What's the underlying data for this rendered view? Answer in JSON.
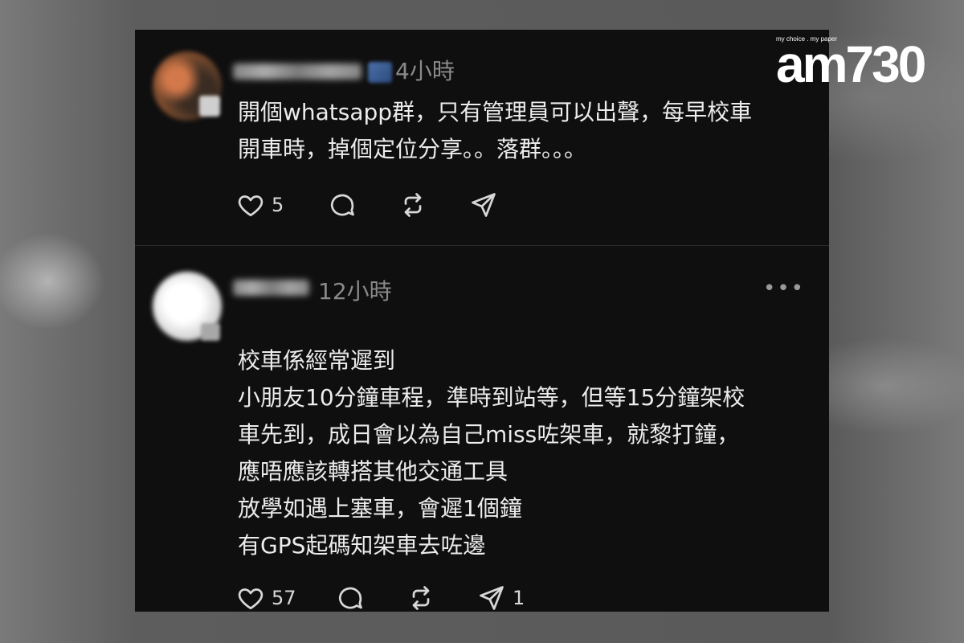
{
  "brand": {
    "tagline": "my choice . my paper",
    "logo_text": "am730"
  },
  "posts": [
    {
      "time": "4小時",
      "text": "開個whatsapp群，只有管理員可以出聲，每早校車\n開車時，掉個定位分享。。落群。。。",
      "likes": "5",
      "shares": ""
    },
    {
      "time": "12小時",
      "more_icon": "•••",
      "text": "校車係經常遲到\n小朋友10分鐘車程，準時到站等，但等15分鐘架校\n車先到，成日會以為自己miss咗架車，就黎打鐘，\n應唔應該轉搭其他交通工具\n放學如遇上塞車，會遲1個鐘\n有GPS起碼知架車去咗邊",
      "likes": "57",
      "shares": "1"
    }
  ],
  "icons": {
    "like": "heart-icon",
    "reply": "speech-bubble-icon",
    "repost": "repost-icon",
    "share": "paper-plane-icon"
  },
  "colors": {
    "panel": "#0f0f0f",
    "text": "#ececec",
    "muted": "#8a8a8a"
  }
}
